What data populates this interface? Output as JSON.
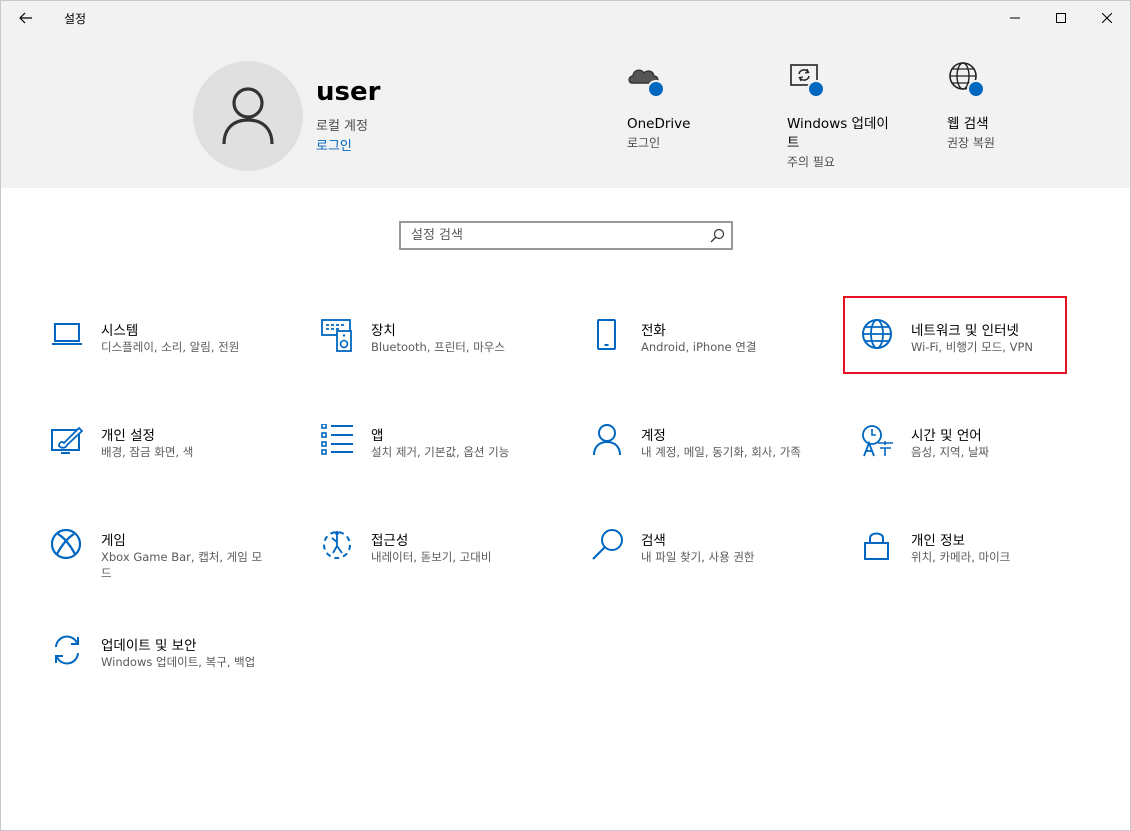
{
  "window": {
    "title": "설정"
  },
  "account": {
    "name": "user",
    "type": "로컬 계정",
    "login_link": "로그인"
  },
  "quick_links": [
    {
      "id": "onedrive",
      "title": "OneDrive",
      "subtitle": "로그인",
      "icon": "cloud-icon"
    },
    {
      "id": "windows-update",
      "title_line1": "Windows 업데이",
      "title_line2": "트",
      "subtitle": "주의 필요",
      "icon": "update-icon"
    },
    {
      "id": "web-search",
      "title": "웹 검색",
      "subtitle": "권장 복원",
      "icon": "globe-icon"
    }
  ],
  "search": {
    "placeholder": "설정 검색"
  },
  "categories": [
    {
      "title": "시스템",
      "subtitle": "디스플레이, 소리, 알림, 전원",
      "icon": "laptop-icon"
    },
    {
      "title": "장치",
      "subtitle": "Bluetooth, 프린터, 마우스",
      "icon": "devices-icon"
    },
    {
      "title": "전화",
      "subtitle": "Android, iPhone 연결",
      "icon": "phone-icon"
    },
    {
      "title": "네트워크 및 인터넷",
      "subtitle": "Wi-Fi, 비행기 모드, VPN",
      "icon": "globe-icon"
    },
    {
      "title": "개인 설정",
      "subtitle": "배경, 잠금 화면, 색",
      "icon": "personalization-icon"
    },
    {
      "title": "앱",
      "subtitle": "설치 제거, 기본값, 옵션 기능",
      "icon": "apps-list-icon"
    },
    {
      "title": "계정",
      "subtitle": "내 계정, 메일, 동기화, 회사, 가족",
      "icon": "person-icon"
    },
    {
      "title": "시간 및 언어",
      "subtitle": "음성, 지역, 날짜",
      "icon": "time-language-icon"
    },
    {
      "title": "게임",
      "subtitle": "Xbox Game Bar, 캡처, 게임 모드",
      "icon": "xbox-icon"
    },
    {
      "title": "접근성",
      "subtitle": "내레이터, 돋보기, 고대비",
      "icon": "accessibility-icon"
    },
    {
      "title": "검색",
      "subtitle": "내 파일 찾기, 사용 권한",
      "icon": "search-icon"
    },
    {
      "title": "개인 정보",
      "subtitle": "위치, 카메라, 마이크",
      "icon": "lock-icon"
    },
    {
      "title": "업데이트 및 보안",
      "subtitle": "Windows 업데이트, 복구, 백업",
      "icon": "sync-icon"
    }
  ],
  "colors": {
    "accent": "#0067c0",
    "highlight": "#e81123",
    "header_bg": "#f2f2f2"
  }
}
